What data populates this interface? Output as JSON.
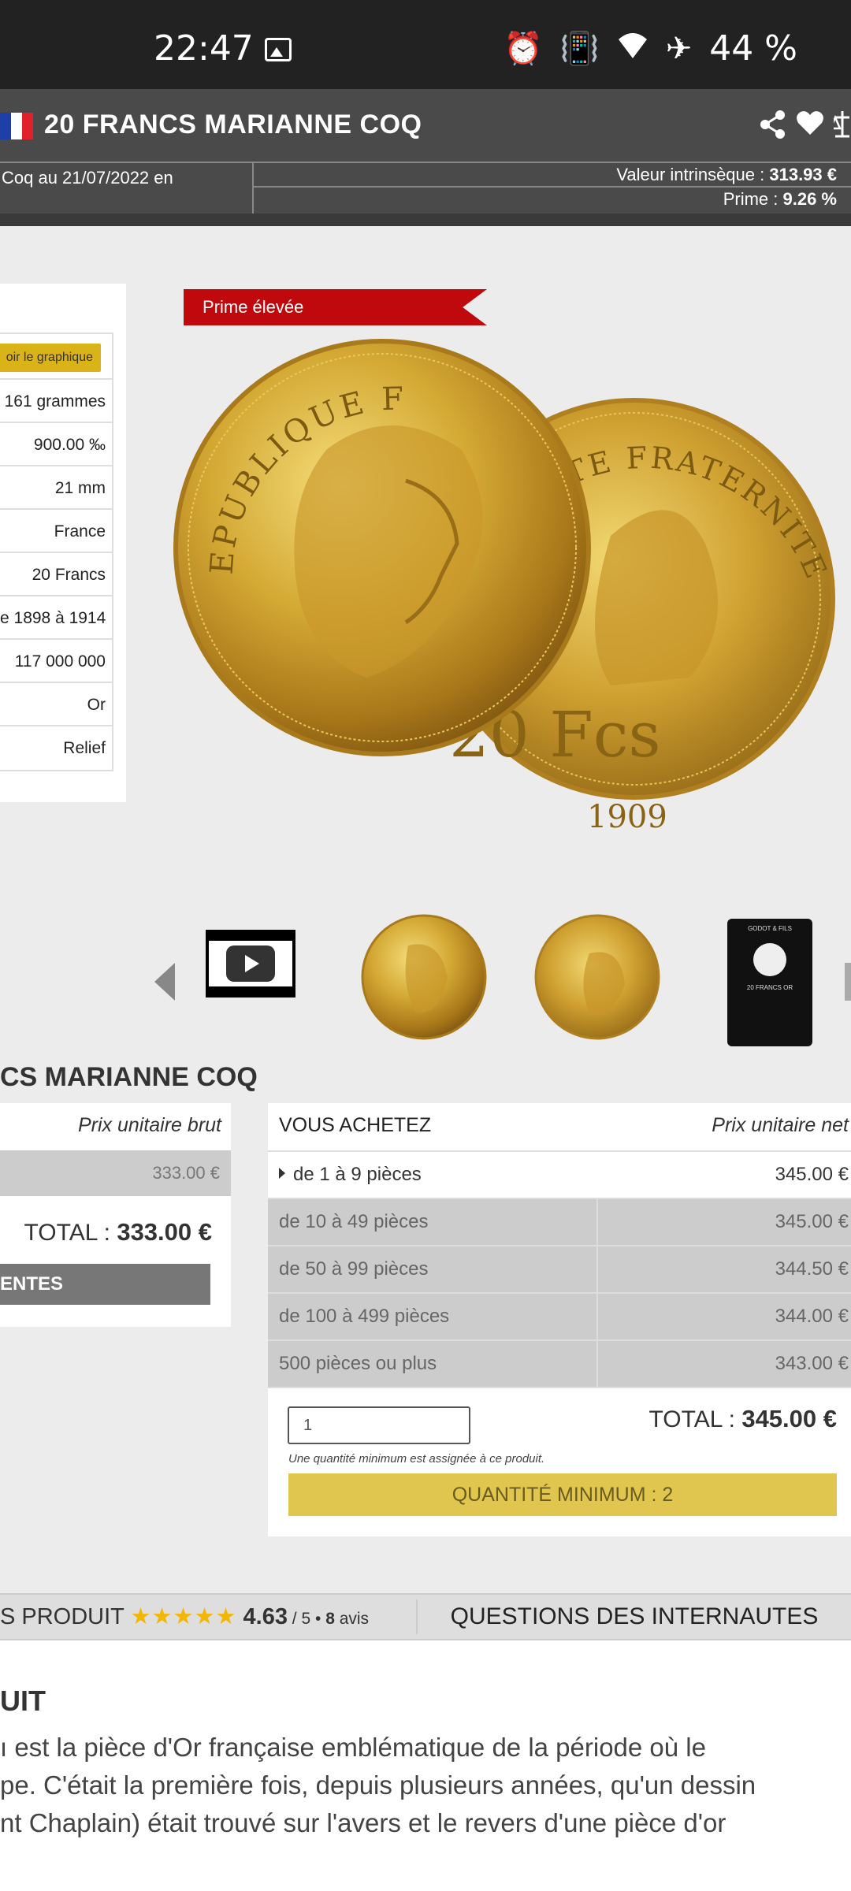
{
  "status_bar": {
    "time": "22:47",
    "battery": "44 %",
    "icons": [
      "image-icon",
      "alarm-icon",
      "vibrate-icon",
      "wifi-icon",
      "airplane-icon"
    ]
  },
  "header": {
    "title": "20 FRANCS MARIANNE COQ",
    "icons": [
      "share-icon",
      "heart-icon",
      "compare-scale-icon"
    ],
    "sub_left": "Coq au 21/07/2022 en",
    "intrinsic_label": "Valeur intrinsèque : ",
    "intrinsic_value": "313.93 €",
    "premium_label": "Prime : ",
    "premium_value": "9.26 %"
  },
  "specs": {
    "chart_button": "oir le graphique",
    "rows": [
      "161 grammes",
      "900.00 ‰",
      "21 mm",
      "France",
      "20 Francs",
      "e 1898 à 1914",
      "117 000 000",
      "Or",
      "Relief"
    ]
  },
  "image": {
    "ribbon": "Prime élevée",
    "obverse_text": "EPUBLIQUE FRANÇAISE",
    "reverse_text": "LITE FRATERNITE",
    "reverse_value": "20 Fcs",
    "reverse_year": "1909"
  },
  "thumbnails": {
    "card_lines": [
      "GODOT & FILS",
      "20 FRANCS OR"
    ]
  },
  "product_title": "CS MARIANNE COQ",
  "left_card": {
    "header": "Prix unitaire brut",
    "price": "333.00 €",
    "total_label": "TOTAL : ",
    "total_value": "333.00 €",
    "button": "ENTES"
  },
  "right_card": {
    "header_left": "VOUS ACHETEZ",
    "header_right": "Prix unitaire net",
    "rows": [
      {
        "label": "de 1 à 9 pièces",
        "price": "345.00 €"
      },
      {
        "label": "de 10 à 49 pièces",
        "price": "345.00 €"
      },
      {
        "label": "de 50 à 99 pièces",
        "price": "344.50 €"
      },
      {
        "label": "de 100 à 499 pièces",
        "price": "344.00 €"
      },
      {
        "label": "500 pièces ou plus",
        "price": "343.00 €"
      }
    ],
    "quantity": "1",
    "total_label": "TOTAL : ",
    "total_value": "345.00 €",
    "note": "Une quantité minimum est assignée à ce produit.",
    "button": "QUANTITÉ MINIMUM : 2"
  },
  "tabs": {
    "left_label": "S PRODUIT",
    "rating": "4.63",
    "rating_scale": " / 5 • ",
    "reviews_count": "8",
    "reviews_word": " avis",
    "right_label": "QUESTIONS DES INTERNAUTES"
  },
  "description": {
    "title": "UIT",
    "lines": [
      "ı est la pièce d'Or française emblématique de la période où le",
      "pe. C'était la première fois, depuis plusieurs années, qu'un dessin",
      "nt Chaplain) était trouvé sur l'avers et le revers d'une pièce d'or"
    ]
  },
  "colors": {
    "header_bg": "#4a4a4a",
    "ribbon": "#c0090c",
    "gold_button": "#e0c64e",
    "chart_button": "#d9b318",
    "stars": "#f2b705"
  }
}
